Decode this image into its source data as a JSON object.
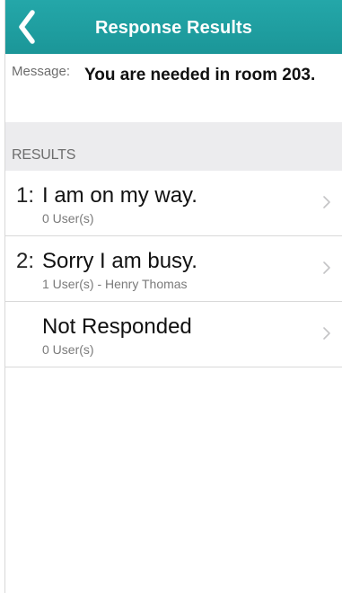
{
  "nav": {
    "title": "Response Results",
    "back_icon": "chevron-left-icon",
    "bar_color": "#1e9c9e"
  },
  "message": {
    "label": "Message:",
    "text": "You are needed in room 203."
  },
  "results_section": {
    "header": "RESULTS",
    "items": [
      {
        "number": "1:",
        "title": "I am on my way.",
        "subtitle": "0 User(s)"
      },
      {
        "number": "2:",
        "title": "Sorry I am busy.",
        "subtitle": "1 User(s) - Henry Thomas"
      },
      {
        "number": "",
        "title": "Not Responded",
        "subtitle": "0 User(s)"
      }
    ],
    "row_icon": "chevron-right-icon"
  }
}
